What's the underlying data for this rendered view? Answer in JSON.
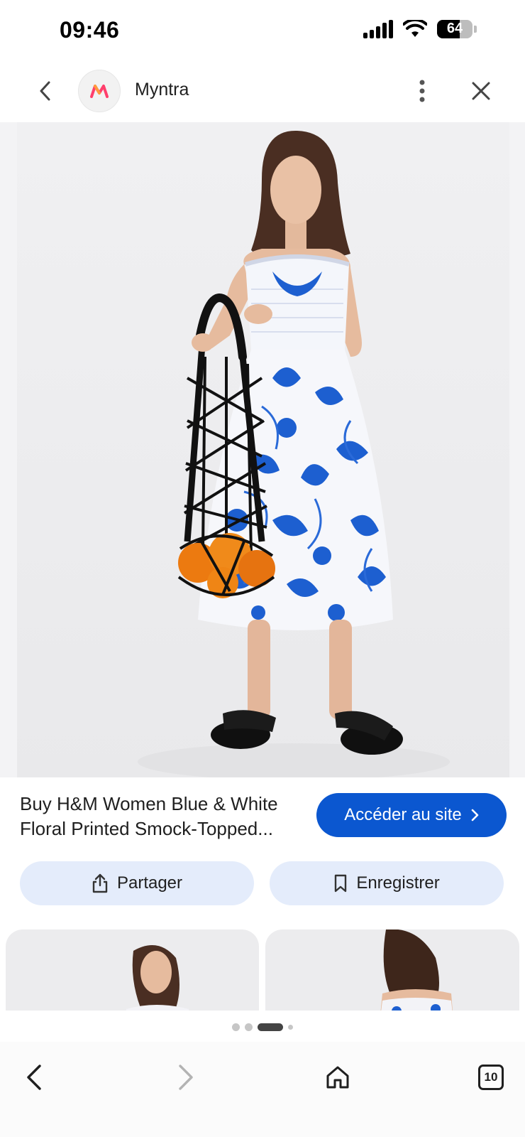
{
  "status_bar": {
    "time": "09:46",
    "battery_level": "64"
  },
  "header": {
    "site_name": "Myntra",
    "logo_letter": "M",
    "logo_color": "#ff3f6c"
  },
  "product": {
    "title_line1": "Buy H&M Women Blue & White",
    "title_line2": "Floral Printed Smock-Topped..."
  },
  "buttons": {
    "visit_label": "Accéder au site",
    "share_label": "Partager",
    "save_label": "Enregistrer"
  },
  "bottom_nav": {
    "tabs_count": "10"
  },
  "colors": {
    "primary": "#0b57d0",
    "chip_bg": "#e4ecfb",
    "dress_blue": "#1d5fd0"
  }
}
